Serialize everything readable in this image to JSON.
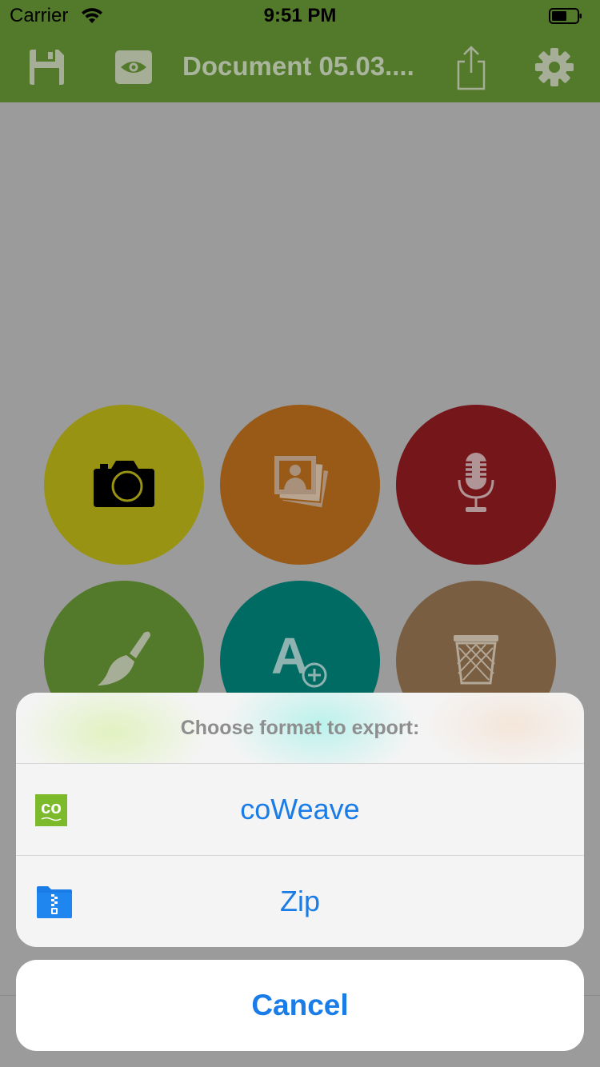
{
  "status_bar": {
    "carrier": "Carrier",
    "time": "9:51 PM"
  },
  "nav": {
    "title": "Document 05.03....",
    "icons": [
      "save-icon",
      "preview-eye-icon",
      "share-icon",
      "settings-gear-icon"
    ]
  },
  "actions": [
    {
      "name": "camera",
      "icon": "camera-icon",
      "color": "#999313"
    },
    {
      "name": "photos",
      "icon": "photo-stack-icon",
      "color": "#985a16"
    },
    {
      "name": "microphone",
      "icon": "microphone-icon",
      "color": "#75161b"
    },
    {
      "name": "draw",
      "icon": "paintbrush-icon",
      "color": "#53792a"
    },
    {
      "name": "add-text",
      "icon": "add-text-icon",
      "color": "#006b63"
    },
    {
      "name": "delete",
      "icon": "trash-icon",
      "color": "#795e42"
    }
  ],
  "sheet": {
    "title": "Choose format to export:",
    "options": [
      {
        "label": "coWeave",
        "icon": "coweave-logo-icon",
        "logo_text": "co"
      },
      {
        "label": "Zip",
        "icon": "zip-folder-icon"
      }
    ],
    "cancel_label": "Cancel"
  },
  "colors": {
    "nav_background": "#53792a",
    "accent_blue": "#1a7ce6",
    "dim_overlay": "#9b9b9b"
  }
}
